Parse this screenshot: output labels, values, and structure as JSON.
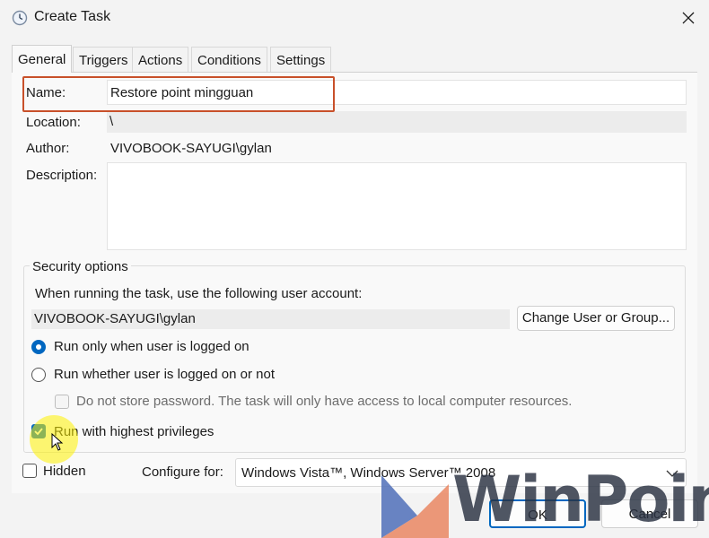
{
  "window": {
    "title": "Create Task",
    "close_icon": "close-icon"
  },
  "tabs": [
    {
      "label": "General",
      "active": true
    },
    {
      "label": "Triggers",
      "active": false
    },
    {
      "label": "Actions",
      "active": false
    },
    {
      "label": "Conditions",
      "active": false
    },
    {
      "label": "Settings",
      "active": false
    }
  ],
  "general": {
    "name_label": "Name:",
    "name_value": "Restore point mingguan",
    "location_label": "Location:",
    "location_value": "\\",
    "author_label": "Author:",
    "author_value": "VIVOBOOK-SAYUGI\\gylan",
    "description_label": "Description:",
    "description_value": ""
  },
  "security": {
    "title": "Security options",
    "account_prompt": "When running the task, use the following user account:",
    "account_value": "VIVOBOOK-SAYUGI\\gylan",
    "change_user_button": "Change User or Group...",
    "radio_logged_on": "Run only when user is logged on",
    "radio_whether": "Run whether user is logged on or not",
    "no_store_password": "Do not store password.  The task will only have access to local computer resources.",
    "highest_privileges": "Run with highest privileges"
  },
  "footer": {
    "hidden_label": "Hidden",
    "configure_label": "Configure for:",
    "configure_value": "Windows Vista™, Windows Server™ 2008",
    "ok_button": "OK",
    "cancel_button": "Cancel"
  },
  "watermark": {
    "text": "WinPoin"
  },
  "colors": {
    "accent": "#0067c0",
    "name_highlight": "#c8502a",
    "watermark_dark": "#2a3242",
    "watermark_blue": "#4f6fb8",
    "watermark_orange": "#e8784f"
  }
}
